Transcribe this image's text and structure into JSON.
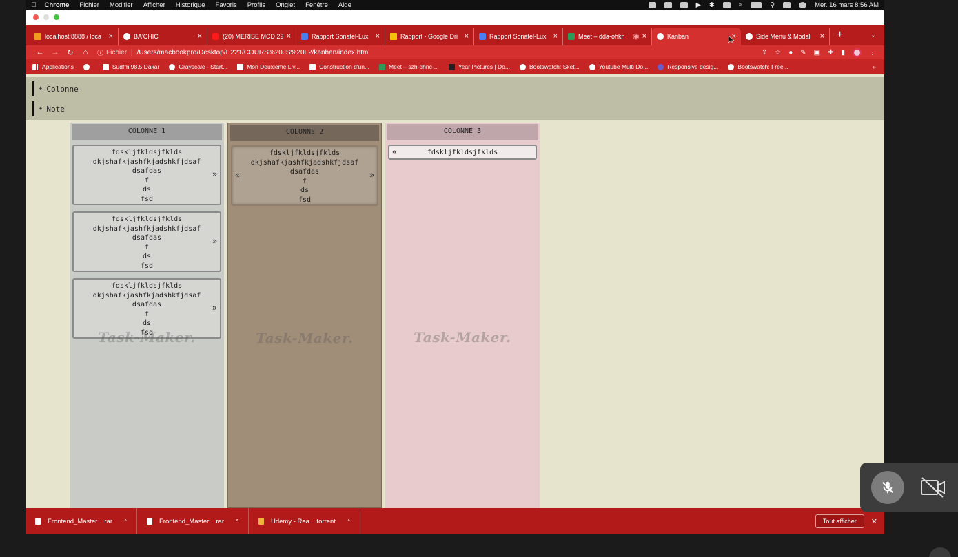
{
  "menubar": {
    "app": "Chrome",
    "items": [
      "Fichier",
      "Modifier",
      "Afficher",
      "Historique",
      "Favoris",
      "Profils",
      "Onglet",
      "Fenêtre",
      "Aide"
    ],
    "datetime": "Mer. 16 mars  8:56 AM"
  },
  "tabs": [
    {
      "label": "localhost:8888 / loca",
      "icon": "lh"
    },
    {
      "label": "BA'CHIC",
      "icon": "circle"
    },
    {
      "label": "(20) MERISE MCD 29",
      "icon": "yt"
    },
    {
      "label": "Rapport Sonatel-Lux",
      "icon": "sq"
    },
    {
      "label": "Rapport - Google Dri",
      "icon": "dr"
    },
    {
      "label": "Rapport Sonatel-Lux",
      "icon": "sq"
    },
    {
      "label": "Meet – dda-ohkn",
      "icon": "mt"
    },
    {
      "label": "Kanban",
      "icon": "circle",
      "active": true
    },
    {
      "label": "Side Menu & Modal",
      "icon": "circle"
    }
  ],
  "address": {
    "scheme": "Fichier",
    "url": "/Users/macbookpro/Desktop/E221/COURS%20JS%20L2/kanban/index.html"
  },
  "bookmarks": [
    "Applications",
    "",
    "Sudfm 98.5 Dakar",
    "Grayscale - Start...",
    "Mon Deuxieme Liv...",
    "Construction d'un...",
    "Meet – szh-dhnc-...",
    "Year Pictures | Do...",
    "Bootswatch: Sket...",
    "Youtube Multi Do...",
    "Responsive desig...",
    "Bootswatch: Free..."
  ],
  "controls": {
    "add_column": "Colonne",
    "add_note": "Note"
  },
  "watermark": "Task-Maker.",
  "columns": [
    {
      "title": "COLONNE 1",
      "notes": [
        {
          "text": "fdskljfkldsjfklds\ndkjshafkjashfkjadshkfjdsaf\ndsafdas\nf\nds\nfsd",
          "left": false,
          "right": true
        },
        {
          "text": "fdskljfkldsjfklds\ndkjshafkjashfkjadshkfjdsaf\ndsafdas\nf\nds\nfsd",
          "left": false,
          "right": true
        },
        {
          "text": "fdskljfkldsjfklds\ndkjshafkjashfkjadshkfjdsaf\ndsafdas\nf\nds\nfsd",
          "left": false,
          "right": true
        }
      ]
    },
    {
      "title": "COLONNE 2",
      "notes": [
        {
          "text": "fdskljfkldsjfklds\ndkjshafkjashfkjadshkfjdsaf\ndsafdas\nf\nds\nfsd",
          "left": true,
          "right": true
        }
      ]
    },
    {
      "title": "COLONNE 3",
      "notes": [
        {
          "text": "fdskljfkldsjfklds",
          "left": true,
          "right": false
        }
      ]
    }
  ],
  "arrows": {
    "right": "»",
    "left": "«"
  },
  "downloads": {
    "items": [
      "Frontend_Master....rar",
      "Frontend_Master....rar",
      "Udemy - Rea....torrent"
    ],
    "show_all": "Tout afficher"
  }
}
